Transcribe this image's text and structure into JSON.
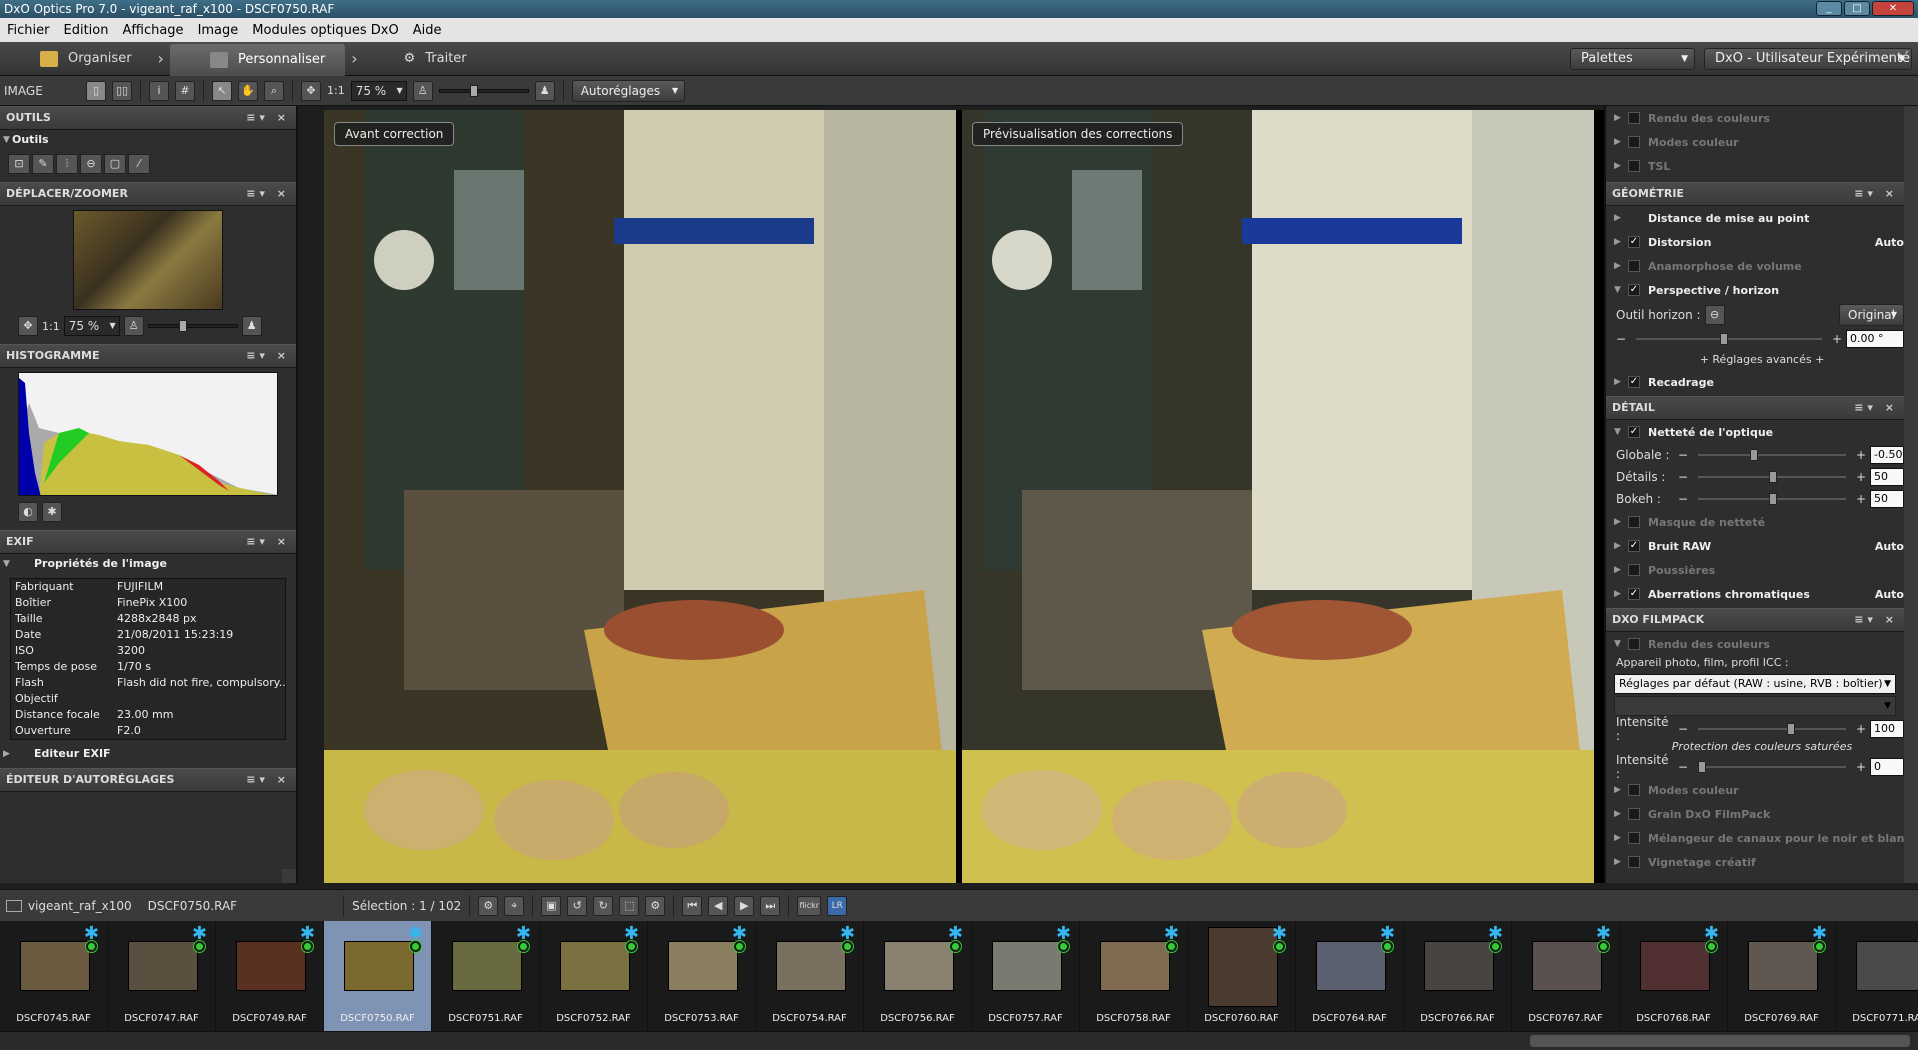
{
  "window": {
    "title": "DxO Optics Pro 7.0 - vigeant_raf_x100 - DSCF0750.RAF",
    "min": "_",
    "max": "□",
    "close": "✕"
  },
  "menu": [
    "Fichier",
    "Edition",
    "Affichage",
    "Image",
    "Modules optiques DxO",
    "Aide"
  ],
  "modes": [
    {
      "label": "Organiser"
    },
    {
      "label": "Personnaliser"
    },
    {
      "label": "Traiter"
    }
  ],
  "header_right": {
    "palettes": "Palettes",
    "workspace": "DxO - Utilisateur Expérimenté"
  },
  "toolbar": {
    "image_label": "IMAGE",
    "zoom": "75 %",
    "one_to_one": "1:1",
    "auto": "Autoréglages"
  },
  "left": {
    "outils_head": "OUTILS",
    "outils_sub": "Outils",
    "zoom_head": "DÉPLACER/ZOOMER",
    "zoom_val": "75 %",
    "one": "1:1",
    "histo_head": "HISTOGRAMME",
    "exif_head": "EXIF",
    "exif_sub": "Propriétés de l'image",
    "exif_rows": [
      {
        "k": "Fabriquant",
        "v": "FUJIFILM"
      },
      {
        "k": "Boîtier",
        "v": "FinePix X100"
      },
      {
        "k": "Taille",
        "v": "4288x2848 px"
      },
      {
        "k": "Date",
        "v": "21/08/2011 15:23:19"
      },
      {
        "k": "ISO",
        "v": "3200"
      },
      {
        "k": "Temps de pose",
        "v": "1/70 s"
      },
      {
        "k": "Flash",
        "v": "Flash did not fire, compulsory..."
      },
      {
        "k": "Objectif",
        "v": ""
      },
      {
        "k": "Distance focale",
        "v": "23.00 mm"
      },
      {
        "k": "Ouverture",
        "v": "F2.0"
      }
    ],
    "exif_editor": "Editeur EXIF",
    "auto_head": "ÉDITEUR D'AUTORÉGLAGES"
  },
  "viewer": {
    "before": "Avant correction",
    "after": "Prévisualisation des corrections"
  },
  "right": {
    "top_rows": [
      {
        "label": "Rendu des couleurs"
      },
      {
        "label": "Modes couleur"
      },
      {
        "label": "TSL"
      }
    ],
    "geo_head": "GÉOMÉTRIE",
    "geo_rows": [
      {
        "label": "Distance de mise au point",
        "checked": false,
        "dim": false,
        "status": "",
        "cb": false
      },
      {
        "label": "Distorsion",
        "checked": true,
        "dim": false,
        "status": "Auto",
        "cb": true
      },
      {
        "label": "Anamorphose de volume",
        "checked": false,
        "dim": true,
        "status": "",
        "cb": true
      },
      {
        "label": "Perspective / horizon",
        "checked": true,
        "dim": false,
        "status": "",
        "cb": true
      }
    ],
    "horizon_label": "Outil horizon :",
    "original_btn": "Original",
    "horizon_val": "0.00 °",
    "advanced": "+ Réglages avancés +",
    "recadrage": "Recadrage",
    "detail_head": "DÉTAIL",
    "nettete": "Netteté de l'optique",
    "sliders": [
      {
        "name": "Globale :",
        "val": "-0.50"
      },
      {
        "name": "Détails :",
        "val": "50"
      },
      {
        "name": "Bokeh :",
        "val": "50"
      }
    ],
    "detail_rows": [
      {
        "label": "Masque de netteté",
        "checked": false,
        "dim": true,
        "status": ""
      },
      {
        "label": "Bruit RAW",
        "checked": true,
        "dim": false,
        "status": "Auto"
      },
      {
        "label": "Poussières",
        "checked": false,
        "dim": true,
        "status": ""
      },
      {
        "label": "Aberrations chromatiques",
        "checked": true,
        "dim": false,
        "status": "Auto"
      }
    ],
    "film_head": "DXO FILMPACK",
    "film_rendu": "Rendu des couleurs",
    "film_label": "Appareil photo, film, profil ICC :",
    "film_select": "Réglages par défaut (RAW : usine, RVB : boîtier)",
    "intensity_label": "Intensité :",
    "intensity1": "100",
    "protect": "Protection des couleurs saturées",
    "intensity2": "0",
    "film_rows": [
      {
        "label": "Modes couleur"
      },
      {
        "label": "Grain DxO FilmPack"
      },
      {
        "label": "Mélangeur de canaux pour le noir et blanc"
      },
      {
        "label": "Vignetage créatif"
      }
    ]
  },
  "filmbar": {
    "folder": "vigeant_raf_x100",
    "file": "DSCF0750.RAF",
    "selection": "Sélection : 1 / 102",
    "flickr": "flickr",
    "lr": "LR"
  },
  "thumbs": [
    "DSCF0745.RAF",
    "DSCF0747.RAF",
    "DSCF0749.RAF",
    "DSCF0750.RAF",
    "DSCF0751.RAF",
    "DSCF0752.RAF",
    "DSCF0753.RAF",
    "DSCF0754.RAF",
    "DSCF0756.RAF",
    "DSCF0757.RAF",
    "DSCF0758.RAF",
    "DSCF0760.RAF",
    "DSCF0764.RAF",
    "DSCF0766.RAF",
    "DSCF0767.RAF",
    "DSCF0768.RAF",
    "DSCF0769.RAF",
    "DSCF0771.RAF"
  ],
  "selected_thumb": "DSCF0750.RAF",
  "colors": {
    "accent": "#35b7f2",
    "selected": "#7f93b5"
  }
}
